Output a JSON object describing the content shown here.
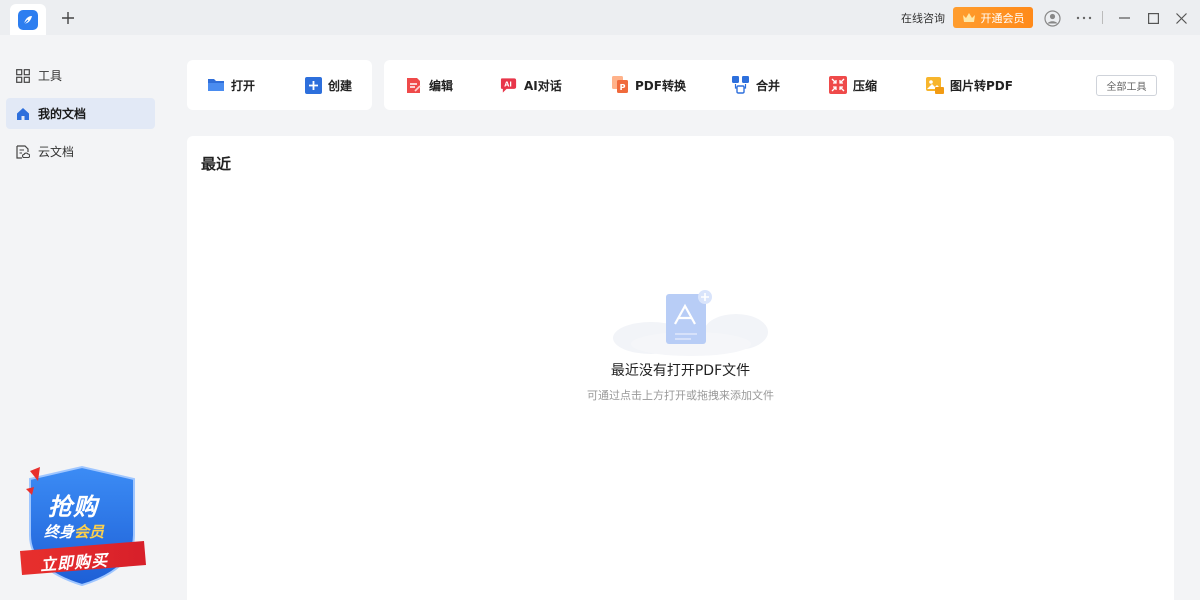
{
  "titlebar": {
    "consult_label": "在线咨询",
    "vip_label": "开通会员"
  },
  "sidebar": {
    "items": [
      {
        "label": "工具",
        "icon": "grid-icon"
      },
      {
        "label": "我的文档",
        "icon": "home-icon",
        "active": true
      },
      {
        "label": "云文档",
        "icon": "cloud-doc-icon"
      }
    ]
  },
  "promo": {
    "line1": "抢购",
    "line2a": "终身",
    "line2b": "会员",
    "button": "立即购买"
  },
  "toolbar": {
    "open": "打开",
    "create": "创建",
    "edit": "编辑",
    "ai_chat": "AI对话",
    "pdf_convert": "PDF转换",
    "merge": "合并",
    "compress": "压缩",
    "image_to_pdf": "图片转PDF",
    "all_tools": "全部工具"
  },
  "recent": {
    "title": "最近",
    "empty_title": "最近没有打开PDF文件",
    "empty_subtitle": "可通过点击上方打开或拖拽来添加文件"
  },
  "colors": {
    "accent": "#2d7ef0",
    "vip": "#ff9020",
    "active_bg": "#e2e9f6"
  }
}
